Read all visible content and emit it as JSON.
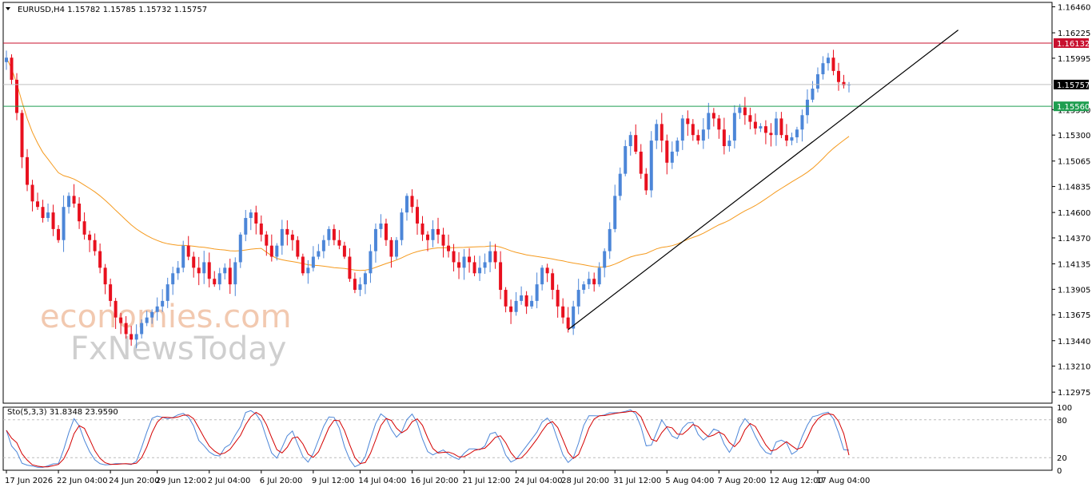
{
  "chart_data": {
    "type": "candlestick",
    "symbol_header": "EURUSD,H4  1.15782 1.15785 1.15732 1.15757",
    "symbol": "EURUSD",
    "timeframe": "H4",
    "ohlc": {
      "open": 1.15782,
      "high": 1.15785,
      "low": 1.15732,
      "close": 1.15757
    },
    "y_range": [
      1.12875,
      1.165
    ],
    "y_ticks": [
      "1.16460",
      "1.16225",
      "1.15995",
      "1.15530",
      "1.15300",
      "1.15065",
      "1.14835",
      "1.14600",
      "1.14370",
      "1.14135",
      "1.13905",
      "1.13675",
      "1.13440",
      "1.13210",
      "1.12975"
    ],
    "x_ticks": [
      "17 Jun 2026",
      "22 Jun 04:00",
      "24 Jun 20:00",
      "29 Jun 12:00",
      "2 Jul 04:00",
      "6 Jul 20:00",
      "9 Jul 12:00",
      "14 Jul 04:00",
      "16 Jul 20:00",
      "21 Jul 12:00",
      "24 Jul 04:00",
      "28 Jul 20:00",
      "31 Jul 12:00",
      "5 Aug 04:00",
      "7 Aug 20:00",
      "12 Aug 12:00",
      "17 Aug 04:00"
    ],
    "price_levels": [
      {
        "label": "1.16132",
        "value": 1.16132,
        "color": "#c8102e"
      },
      {
        "label": "1.15757",
        "value": 1.15757,
        "color": "#000000"
      },
      {
        "label": "1.15560",
        "value": 1.1556,
        "color": "#1e9e50"
      }
    ],
    "closes": [
      1.16,
      1.158,
      1.155,
      1.151,
      1.1485,
      1.147,
      1.1465,
      1.1455,
      1.146,
      1.1445,
      1.1435,
      1.1465,
      1.1475,
      1.1468,
      1.1452,
      1.144,
      1.1435,
      1.1425,
      1.141,
      1.1395,
      1.138,
      1.1365,
      1.136,
      1.135,
      1.1345,
      1.135,
      1.136,
      1.1365,
      1.137,
      1.1375,
      1.138,
      1.1395,
      1.1405,
      1.141,
      1.143,
      1.142,
      1.141,
      1.1405,
      1.1415,
      1.14,
      1.1395,
      1.1405,
      1.141,
      1.1395,
      1.1415,
      1.144,
      1.1455,
      1.146,
      1.145,
      1.144,
      1.143,
      1.142,
      1.143,
      1.1445,
      1.144,
      1.1435,
      1.142,
      1.1405,
      1.141,
      1.142,
      1.1425,
      1.1435,
      1.1445,
      1.1435,
      1.143,
      1.142,
      1.14,
      1.139,
      1.1395,
      1.1405,
      1.1425,
      1.1445,
      1.145,
      1.1435,
      1.142,
      1.1435,
      1.146,
      1.1475,
      1.1465,
      1.145,
      1.144,
      1.1435,
      1.1445,
      1.144,
      1.143,
      1.1425,
      1.1415,
      1.141,
      1.142,
      1.1415,
      1.1405,
      1.141,
      1.1415,
      1.1425,
      1.1415,
      1.139,
      1.1375,
      1.137,
      1.138,
      1.1385,
      1.1375,
      1.138,
      1.1395,
      1.141,
      1.1405,
      1.139,
      1.1375,
      1.1365,
      1.1355,
      1.1375,
      1.139,
      1.1395,
      1.14,
      1.1395,
      1.141,
      1.1425,
      1.1445,
      1.1475,
      1.1495,
      1.152,
      1.153,
      1.1515,
      1.1495,
      1.148,
      1.1525,
      1.154,
      1.1525,
      1.1505,
      1.1515,
      1.1525,
      1.1545,
      1.154,
      1.153,
      1.1525,
      1.1535,
      1.155,
      1.1545,
      1.1535,
      1.152,
      1.1525,
      1.155,
      1.1555,
      1.1548,
      1.1542,
      1.1536,
      1.1538,
      1.1532,
      1.153,
      1.1545,
      1.153,
      1.1525,
      1.1528,
      1.1535,
      1.1548,
      1.1562,
      1.1572,
      1.1585,
      1.1595,
      1.16,
      1.1588,
      1.1578,
      1.1575,
      1.1576
    ],
    "moving_average": {
      "color": "#f59a1e",
      "period": 50
    },
    "trendline": {
      "from": {
        "index": 108,
        "value": 1.1354
      },
      "to": {
        "index": 183,
        "value": 1.1625
      }
    },
    "indicator": {
      "name": "Sto(5,3,3)",
      "header": "Sto(5,3,3) 31.8348 23.9590",
      "main": 31.8348,
      "signal": 23.959,
      "range": [
        0,
        100
      ],
      "levels": [
        20,
        80
      ],
      "ticks": [
        "100",
        "80",
        "20",
        "0"
      ],
      "main_color": "#4c86d8",
      "signal_color": "#d40000"
    }
  },
  "colors": {
    "bull": "#4c86d8",
    "bear": "#e8101e",
    "grid": "#cccccc",
    "axis": "#000000"
  },
  "watermark": {
    "line1": "economies.com",
    "line2": "FxNewsToday"
  }
}
